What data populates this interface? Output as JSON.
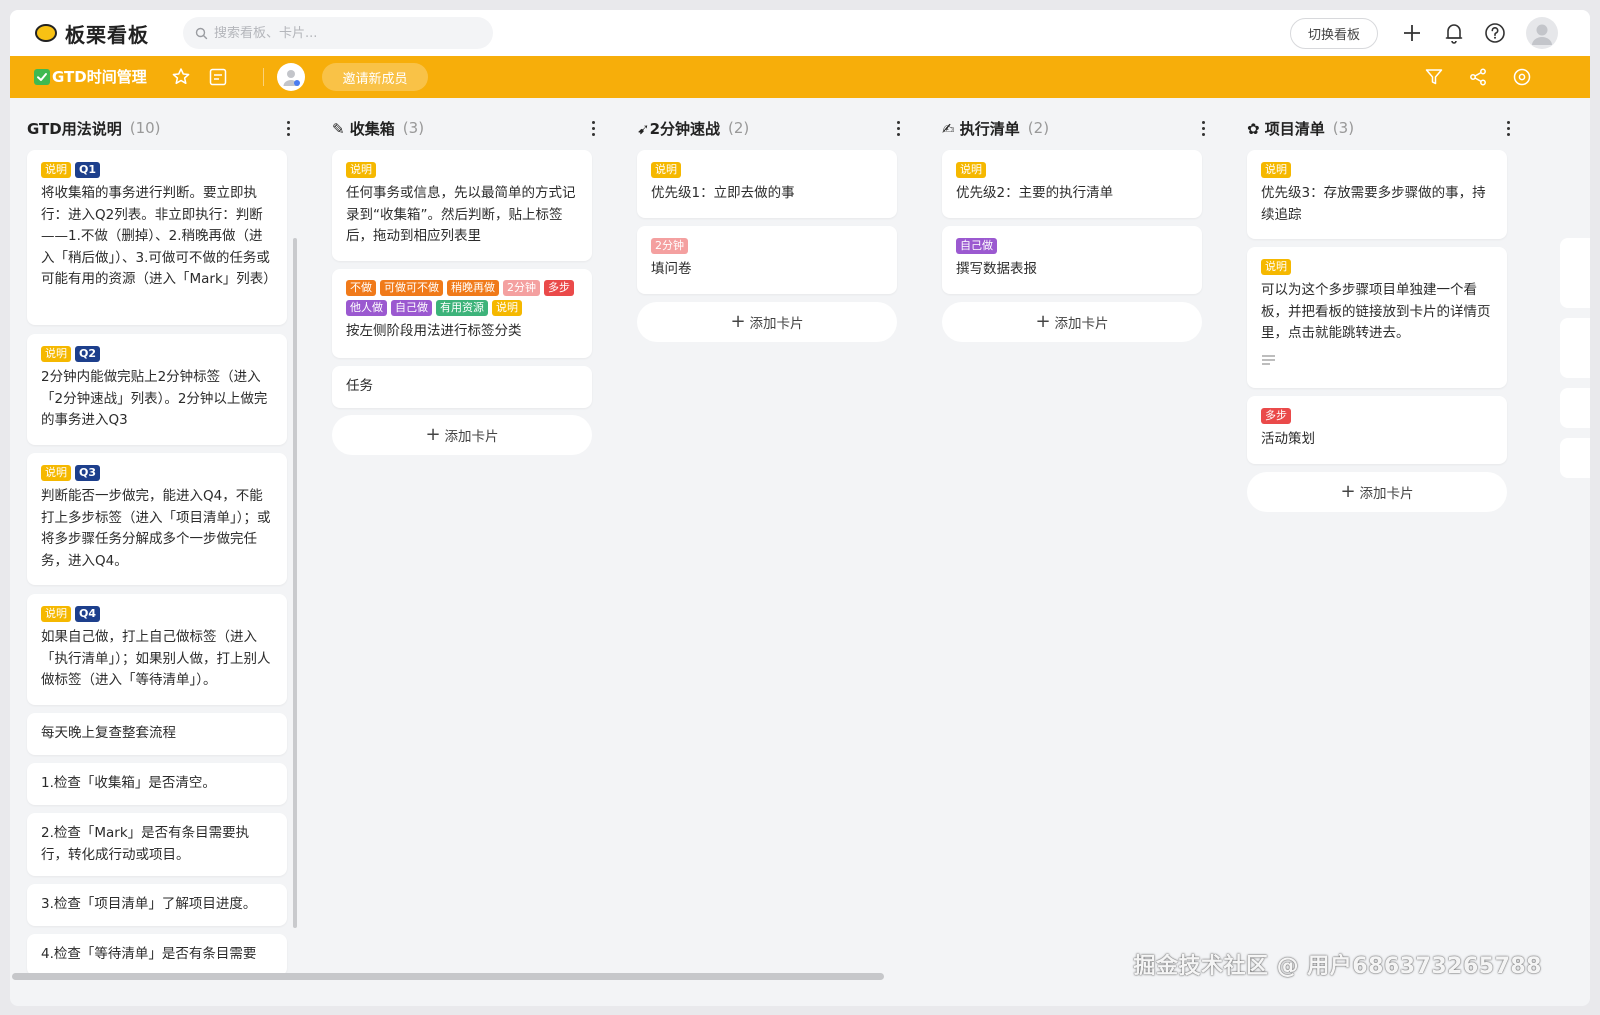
{
  "app": {
    "name": "板栗看板",
    "search_placeholder": "搜索看板、卡片...",
    "switch_board_label": "切换看板"
  },
  "board": {
    "title": "GTD时间管理",
    "invite_label": "邀请新成员"
  },
  "columns": [
    {
      "title": "GTD用法说明",
      "count": "(10)",
      "cards": [
        {
          "tags": [
            {
              "text": "说明",
              "color": "#f5b800"
            },
            {
              "text": "Q1",
              "color": "#1d3f8c"
            }
          ],
          "text": "将收集箱的事务进行判断。要立即执行：进入Q2列表。非立即执行：判断——1.不做（删掉）、2.稍晚再做（进入「稍后做」）、3.可做可不做的任务或可能有用的资源（进入「Mark」列表）"
        },
        {
          "tags": [
            {
              "text": "说明",
              "color": "#f5b800"
            },
            {
              "text": "Q2",
              "color": "#1d3f8c"
            }
          ],
          "text": "2分钟内能做完贴上2分钟标签（进入「2分钟速战」列表）。2分钟以上做完的事务进入Q3"
        },
        {
          "tags": [
            {
              "text": "说明",
              "color": "#f5b800"
            },
            {
              "text": "Q3",
              "color": "#1d3f8c"
            }
          ],
          "text": "判断能否一步做完，能进入Q4，不能打上多步标签（进入「项目清单」）；或将多步骤任务分解成多个一步做完任务，进入Q4。"
        },
        {
          "tags": [
            {
              "text": "说明",
              "color": "#f5b800"
            },
            {
              "text": "Q4",
              "color": "#1d3f8c"
            }
          ],
          "text": "如果自己做，打上自己做标签（进入「执行清单」）；如果别人做，打上别人做标签（进入「等待清单」）。"
        },
        {
          "tags": [],
          "text": "每天晚上复查整套流程"
        },
        {
          "tags": [],
          "text": "1.检查「收集箱」是否清空。"
        },
        {
          "tags": [],
          "text": "2.检查「Mark」是否有条目需要执行，转化成行动或项目。"
        },
        {
          "tags": [],
          "text": "3.检查「项目清单」了解项目进度。"
        },
        {
          "tags": [],
          "text": "4.检查「等待清单」是否有条目需要"
        }
      ]
    },
    {
      "title": "✎ 收集箱",
      "count": "(3)",
      "cards": [
        {
          "tags": [
            {
              "text": "说明",
              "color": "#f5b800"
            }
          ],
          "text": "任何事务或信息，先以最简单的方式记录到“收集箱”。然后判断，贴上标签后，拖动到相应列表里"
        },
        {
          "tags": [
            {
              "text": "不做",
              "color": "#f07a1a"
            },
            {
              "text": "可做可不做",
              "color": "#f07a1a"
            },
            {
              "text": "稍晚再做",
              "color": "#f07a1a"
            },
            {
              "text": "2分钟",
              "color": "#f4a0a0"
            },
            {
              "text": "多步",
              "color": "#ea4a4a"
            },
            {
              "text": "他人做",
              "color": "#9b59d0"
            },
            {
              "text": "自己做",
              "color": "#9b59d0"
            },
            {
              "text": "有用资源",
              "color": "#3db37a"
            },
            {
              "text": "说明",
              "color": "#f5b800"
            }
          ],
          "text": "按左侧阶段用法进行标签分类"
        },
        {
          "tags": [],
          "text": "任务"
        }
      ],
      "add_label": "添加卡片"
    },
    {
      "title": "➹2分钟速战",
      "count": "(2)",
      "cards": [
        {
          "tags": [
            {
              "text": "说明",
              "color": "#f5b800"
            }
          ],
          "text": "优先级1：立即去做的事"
        },
        {
          "tags": [
            {
              "text": "2分钟",
              "color": "#f4a0a0"
            }
          ],
          "text": "填问卷"
        }
      ],
      "add_label": "添加卡片"
    },
    {
      "title": "✍ 执行清单",
      "count": "(2)",
      "cards": [
        {
          "tags": [
            {
              "text": "说明",
              "color": "#f5b800"
            }
          ],
          "text": "优先级2：主要的执行清单"
        },
        {
          "tags": [
            {
              "text": "自己做",
              "color": "#9b59d0"
            }
          ],
          "text": "撰写数据表报"
        }
      ],
      "add_label": "添加卡片"
    },
    {
      "title": "✿ 项目清单",
      "count": "(3)",
      "cards": [
        {
          "tags": [
            {
              "text": "说明",
              "color": "#f5b800"
            }
          ],
          "text": "优先级3：存放需要多步骤做的事，持续追踪"
        },
        {
          "tags": [
            {
              "text": "说明",
              "color": "#f5b800"
            }
          ],
          "text": "可以为这个多步骤项目单独建一个看板，并把看板的链接放到卡片的详情页里，点击就能跳转进去。",
          "has_description_icon": true
        },
        {
          "tags": [
            {
              "text": "多步",
              "color": "#ea4a4a"
            }
          ],
          "text": "活动策划"
        }
      ],
      "add_label": "添加卡片"
    }
  ],
  "watermark": "掘金技术社区 @ 用户686373265788"
}
